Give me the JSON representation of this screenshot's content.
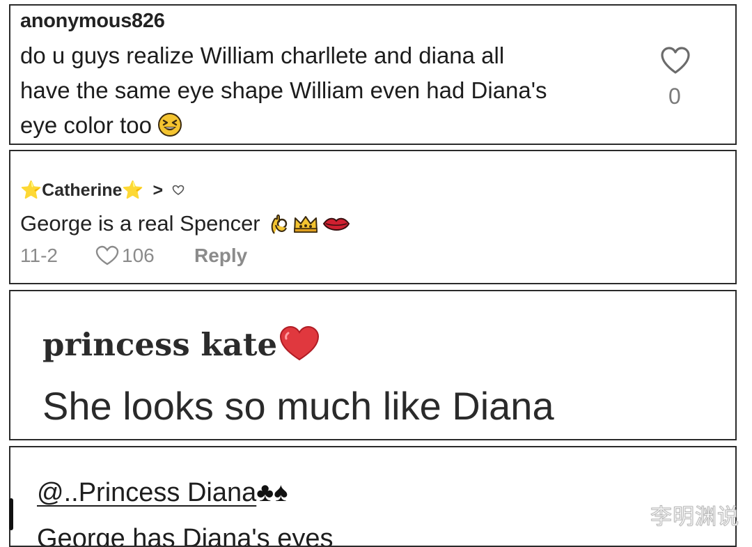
{
  "comments": [
    {
      "username": "anonymous826",
      "text_lines": [
        "do u guys realize William charllete and diana all",
        "have the same eye shape William even had Diana's",
        "eye color too"
      ],
      "emoji": "laughing-squint-emoji",
      "like_count": "0"
    },
    {
      "username": "⭐Catherine⭐",
      "chevron": ">",
      "text": "George is a real Spencer",
      "emojis": [
        "ok-hand-emoji",
        "crown-emoji",
        "lips-emoji"
      ],
      "date": "11-2",
      "like_count": "106",
      "reply_label": "Reply"
    },
    {
      "username": "princess kate",
      "emoji": "heart-emoji",
      "text": "She looks so much like Diana"
    },
    {
      "username": "@..Princess Diana",
      "suits": [
        "♣",
        "♠"
      ],
      "text": "George has Diana's eyes"
    }
  ],
  "watermark": "李明渊说",
  "colors": {
    "border": "#2a2a2a",
    "text": "#1f1f1f",
    "muted": "#8b8b8b",
    "heart_red": "#e0383e",
    "emoji_yellow": "#f4c430"
  }
}
